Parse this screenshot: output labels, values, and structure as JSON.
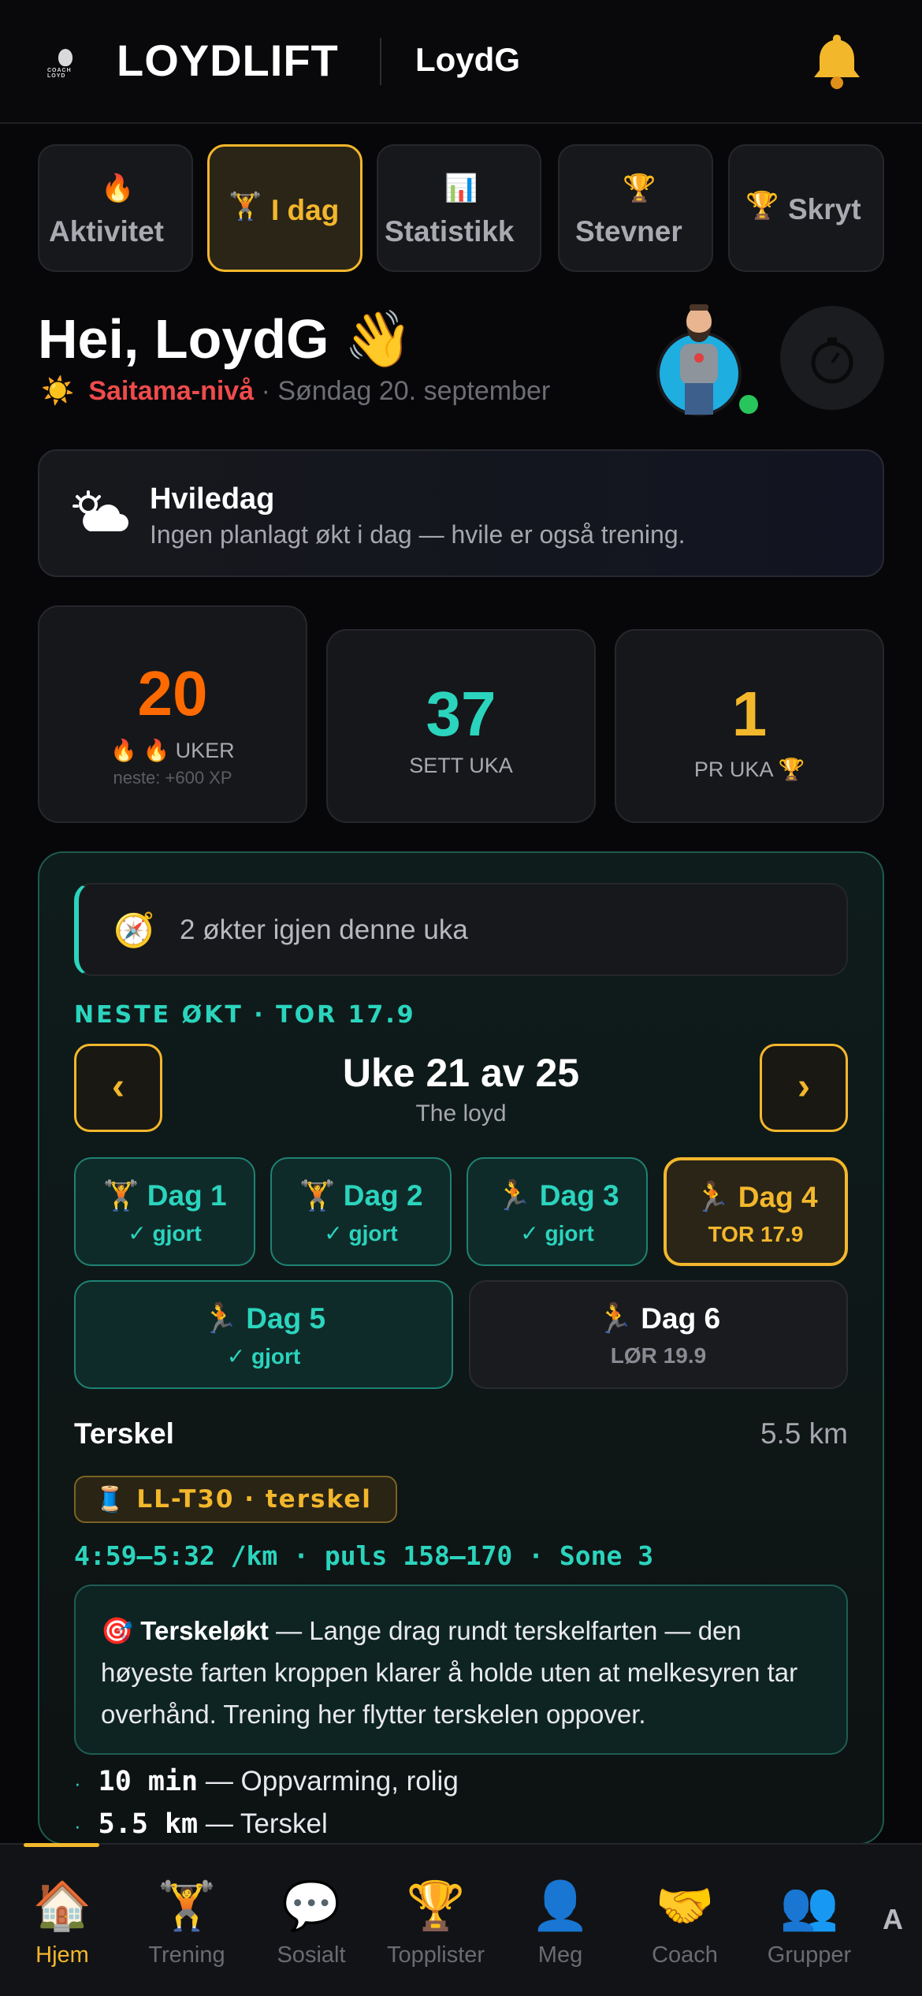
{
  "header": {
    "brand": "LOYDLIFT",
    "logo_text": "COACH LOYD",
    "username": "LoydG"
  },
  "tabs": [
    {
      "icon": "🔥",
      "label": "Aktivitet"
    },
    {
      "icon": "🏋️",
      "label": "I dag",
      "active": true
    },
    {
      "icon": "📊",
      "label": "Statistikk"
    },
    {
      "icon": "🏆",
      "label": "Stevner"
    },
    {
      "icon": "🏆",
      "label": "Skryt"
    }
  ],
  "greeting": {
    "title": "Hei, LoydG 👋",
    "sun_icon": "☀️",
    "level": "Saitama-nivå",
    "date": "· Søndag 20. september"
  },
  "rest": {
    "title": "Hviledag",
    "text": "Ingen planlagt økt i dag — hvile er også trening."
  },
  "stats": {
    "streak": {
      "value": "20",
      "label": "🔥 🔥 UKER",
      "next": "neste: +600 XP"
    },
    "sets": {
      "value": "37",
      "label": "SETT UKA"
    },
    "pr": {
      "value": "1",
      "label": "PR UKA 🏆"
    }
  },
  "plan": {
    "remaining_icon": "🧭",
    "remaining": "2 økter igjen denne uka",
    "next_label": "NESTE ØKT · TOR 17.9",
    "prev": "‹",
    "next": "›",
    "week_title": "Uke 21 av 25",
    "program": "The loyd",
    "days": [
      {
        "icon": "🏋️",
        "label": "Dag 1",
        "status": "✓ gjort"
      },
      {
        "icon": "🏋️",
        "label": "Dag 2",
        "status": "✓ gjort"
      },
      {
        "icon": "🏃",
        "label": "Dag 3",
        "status": "✓ gjort"
      },
      {
        "icon": "🏃",
        "label": "Dag 4",
        "status": "TOR 17.9"
      },
      {
        "icon": "🏃",
        "label": "Dag 5",
        "status": "✓ gjort"
      },
      {
        "icon": "🏃",
        "label": "Dag 6",
        "status": "LØR 19.9"
      }
    ],
    "workout_name": "Terskel",
    "workout_distance": "5.5 km",
    "code": "🧵 LL-T30 · terskel",
    "pace": "4:59–5:32 /km · puls 158–170 · Sone 3",
    "desc_icon": "🎯",
    "desc_bold": "Terskeløkt",
    "desc_text": " — Lange drag rundt terskelfarten — den høyeste farten kroppen klarer å holde uten at melkesyren tar overhånd. Trening her flytter terskelen oppover.",
    "steps": [
      {
        "dot": "·",
        "mono": "10 min",
        "text": " — Oppvarming, rolig"
      },
      {
        "dot": "·",
        "mono": "5.5 km",
        "text": " — Terskel"
      }
    ]
  },
  "bottom_nav": [
    {
      "icon": "🏠",
      "label": "Hjem",
      "active": true
    },
    {
      "icon": "🏋️",
      "label": "Trening"
    },
    {
      "icon": "💬",
      "label": "Sosialt"
    },
    {
      "icon": "🏆",
      "label": "Topplister"
    },
    {
      "icon": "👤",
      "label": "Meg"
    },
    {
      "icon": "🤝",
      "label": "Coach"
    },
    {
      "icon": "👥",
      "label": "Grupper"
    }
  ],
  "fab_letter": "A",
  "colors": {
    "accent": "#f3b72c",
    "teal": "#2bd4bd",
    "orange": "#ff6a00",
    "red": "#ef4b4b",
    "bg": "#070709"
  }
}
